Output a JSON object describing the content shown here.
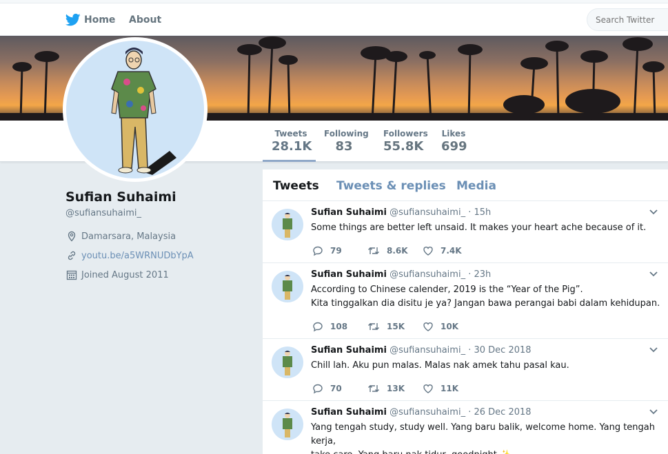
{
  "nav": {
    "home_label": "Home",
    "about_label": "About",
    "search_placeholder": "Search Twitter"
  },
  "stats": {
    "tweets": {
      "label": "Tweets",
      "value": "28.1K"
    },
    "following": {
      "label": "Following",
      "value": "83"
    },
    "followers": {
      "label": "Followers",
      "value": "55.8K"
    },
    "likes": {
      "label": "Likes",
      "value": "699"
    }
  },
  "profile": {
    "name": "Sufian Suhaimi",
    "handle": "@sufiansuhaimi_",
    "location": "Damarsara, Malaysia",
    "link": "youtu.be/a5WRNUDbYpA",
    "joined": "Joined August 2011"
  },
  "timeline": {
    "tabs": [
      "Tweets",
      "Tweets & replies",
      "Media"
    ],
    "tweets": [
      {
        "name": "Sufian Suhaimi",
        "handle": "@sufiansuhaimi_",
        "time": "· 15h",
        "lines": [
          "Some things are better left unsaid. It makes your heart ache because of it."
        ],
        "replies": "79",
        "retweets": "8.6K",
        "likes": "7.4K"
      },
      {
        "name": "Sufian Suhaimi",
        "handle": "@sufiansuhaimi_",
        "time": "· 23h",
        "lines": [
          "According to Chinese calender, 2019 is the “Year of the Pig”.",
          "Kita tinggalkan dia disitu je ya? Jangan bawa perangai babi dalam kehidupan."
        ],
        "replies": "108",
        "retweets": "15K",
        "likes": "10K"
      },
      {
        "name": "Sufian Suhaimi",
        "handle": "@sufiansuhaimi_",
        "time": "· 30 Dec 2018",
        "lines": [
          "Chill lah. Aku pun malas. Malas nak amek tahu pasal kau."
        ],
        "replies": "70",
        "retweets": "13K",
        "likes": "11K"
      },
      {
        "name": "Sufian Suhaimi",
        "handle": "@sufiansuhaimi_",
        "time": "· 26 Dec 2018",
        "lines": [
          "Yang tengah study, study well. Yang baru balik, welcome home. Yang tengah kerja,",
          "take care. Yang baru nak tidur, goodnight ✨"
        ]
      }
    ]
  },
  "colors": {
    "accent": "#1da1f2",
    "link": "#6b8fb5",
    "muted": "#657786",
    "background": "#e6ecf0"
  },
  "icons": [
    "twitter-bird-icon",
    "location-pin-icon",
    "link-icon",
    "calendar-icon",
    "reply-icon",
    "retweet-icon",
    "like-icon",
    "chevron-down-icon"
  ]
}
